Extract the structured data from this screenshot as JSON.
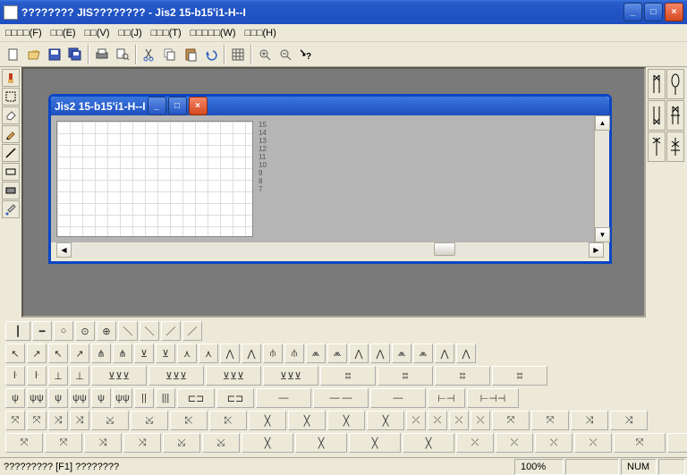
{
  "app": {
    "title": "???????? JIS???????? - Jis2 15-b15'i1-H--I"
  },
  "titlebar": {
    "min": "_",
    "max": "□",
    "close": "×"
  },
  "menu": {
    "items": [
      "□□□□(F)",
      "□□(E)",
      "□□(V)",
      "□□(J)",
      "□□□(T)",
      "□□□□□(W)",
      "□□□(H)"
    ]
  },
  "toolbar": {
    "new": "new",
    "open": "open",
    "save": "save",
    "saveall": "saveall",
    "print": "print",
    "preview": "preview",
    "cut": "cut",
    "copy": "copy",
    "paste": "paste",
    "undo": "undo",
    "grid": "grid",
    "zoomin": "zoomin",
    "zoomout": "zoomout",
    "help": "help"
  },
  "lefttools": [
    "brush",
    "marquee",
    "eraser",
    "pencil",
    "line",
    "rect1",
    "rect2",
    "picker"
  ],
  "righttools": [
    "A1",
    "A2",
    "A3",
    "A4",
    "A5",
    "A6"
  ],
  "mdi": {
    "title": "Jis2 15-b15'i1-H--I",
    "gridrows": [
      "15",
      "14",
      "13",
      "12",
      "11",
      "10",
      "9",
      "8",
      "7"
    ]
  },
  "palette": {
    "row1": [
      "┃",
      "━",
      "○",
      "⊙",
      "⊕",
      "＼",
      "＼",
      "／",
      "／"
    ],
    "row2": [
      "↖",
      "↗",
      "↖",
      "↗",
      "⋔",
      "⋔",
      "⊻",
      "⊻",
      "⋏",
      "⋏",
      "⋀",
      "⋀",
      "⫛",
      "⫛",
      "⩕",
      "⩕",
      "⋀",
      "⋀",
      "⩕",
      "⩕",
      "⋀",
      "⋀"
    ],
    "row3": [
      "ŀ",
      "ŀ",
      "⊥",
      "⊥",
      "⊻⊻⊻",
      "⊻⊻⊻",
      "⊻⊻⊻",
      "⊻⊻⊻",
      "⦂⦂",
      "⦂⦂",
      "⦂⦂",
      "⦂⦂"
    ],
    "row4": [
      "ψ",
      "ψψ",
      "ψ",
      "ψψ",
      "ψ",
      "ψψ",
      "||",
      "|||",
      "⊏⊐",
      "⊏⊐",
      "—",
      "— —",
      "—",
      "⊢⊣",
      "⊢⊣⊣"
    ],
    "row5": [
      "⤧",
      "⤧",
      "⤨",
      "⤨",
      "⤩",
      "⤩",
      "⤪",
      "⤪",
      "╳",
      "╳",
      "╳",
      "╳",
      "⤫",
      "⤫",
      "⤬",
      "⤬",
      "⤧",
      "⤧",
      "⤨",
      "⤨"
    ],
    "row6": [
      "⤧",
      "⤧",
      "⤨",
      "⤨",
      "⤩",
      "⤩",
      "╳",
      "╳",
      "╳",
      "╳",
      "⤫",
      "⤫",
      "⤬",
      "⤬",
      "⤧",
      "⤧"
    ]
  },
  "status": {
    "left": "????????? [F1] ????????",
    "zoom": "100%",
    "blank": "",
    "num": "NUM",
    "blank2": ""
  }
}
